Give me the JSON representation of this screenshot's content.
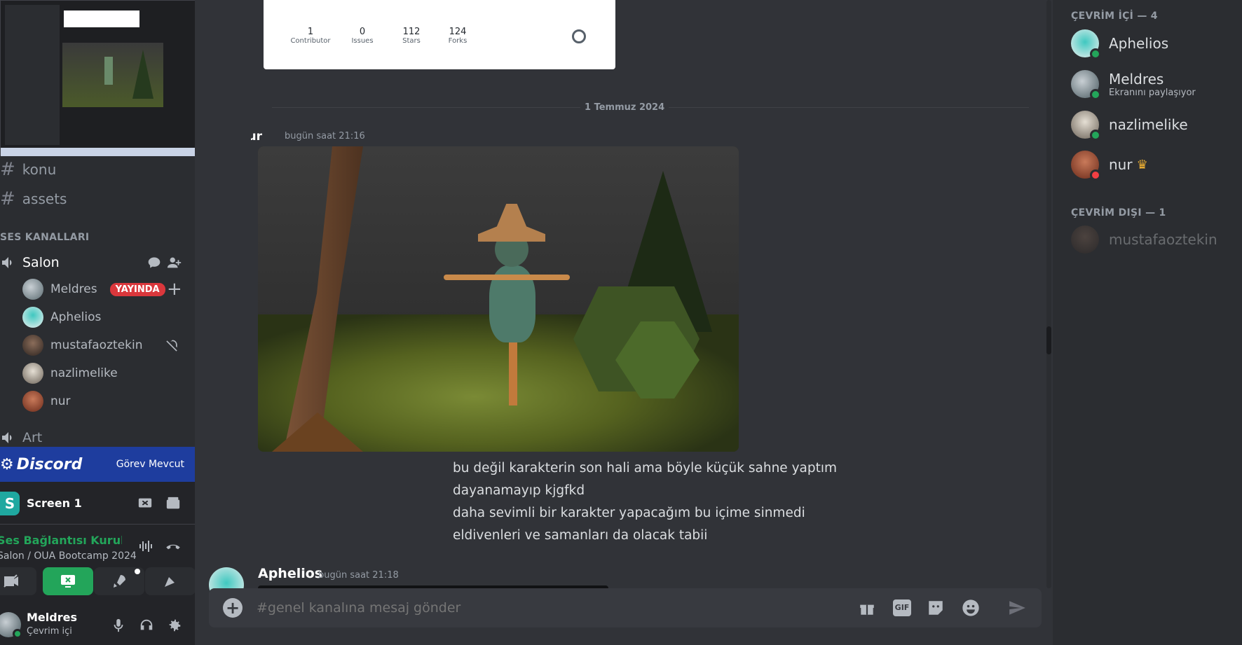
{
  "sidebar": {
    "channels": [
      {
        "label": "konu"
      },
      {
        "label": "assets"
      }
    ],
    "voice_section_label": "SES KANALLARI",
    "voice_channel": "Salon",
    "voice_users": [
      {
        "name": "Meldres",
        "live": "YAYINDA"
      },
      {
        "name": "Aphelios"
      },
      {
        "name": "mustafaoztekin"
      },
      {
        "name": "nazlimelike"
      },
      {
        "name": "nur"
      }
    ],
    "art_channel": "Art",
    "banner_brand": "Discord",
    "banner_action": "Görev Mevcut",
    "screen_label": "Screen 1",
    "screen_avatar_letter": "S",
    "connection_status": "Ses Bağlantısı Kuruldu",
    "connection_location": "Salon / OUA Bootcamp 2024",
    "user_name": "Meldres",
    "user_status": "Çevrim içi"
  },
  "github_card": {
    "stats": [
      {
        "value": "1",
        "label": "Contributor"
      },
      {
        "value": "0",
        "label": "Issues"
      },
      {
        "value": "112",
        "label": "Stars"
      },
      {
        "value": "124",
        "label": "Forks"
      }
    ]
  },
  "date_divider": "1 Temmuz 2024",
  "message1": {
    "author": "nur",
    "time": "bugün saat 21:16",
    "lines": [
      "bu değil karakterin son hali ama böyle küçük sahne yaptım",
      "dayanamayıp kjgfkd",
      "daha sevimli bir karakter yapacağım bu içime sinmedi",
      "eldivenleri ve samanları da olacak tabii"
    ]
  },
  "message2": {
    "author": "Aphelios",
    "time": "bugün saat 21:18"
  },
  "composer": {
    "placeholder": "#genel kanalına mesaj gönder",
    "gif_label": "GIF"
  },
  "members": {
    "online_header": "ÇEVRİM İÇİ — 4",
    "offline_header": "ÇEVRİM DIŞI — 1",
    "online": [
      {
        "name": "Aphelios"
      },
      {
        "name": "Meldres",
        "activity": "Ekranını paylaşıyor"
      },
      {
        "name": "nazlimelike"
      },
      {
        "name": "nur",
        "crown": "♛"
      }
    ],
    "offline": [
      {
        "name": "mustafaoztekin"
      }
    ]
  },
  "colors": {
    "online": "#23a55a",
    "dnd": "#f23f43",
    "live": "#da373c",
    "accent": "#23a55a",
    "banner": "#1e3d9e"
  }
}
